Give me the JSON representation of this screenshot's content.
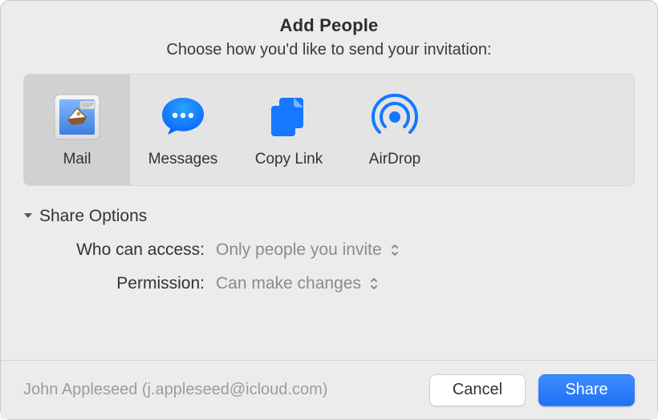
{
  "header": {
    "title": "Add People",
    "subtitle": "Choose how you'd like to send your invitation:"
  },
  "methods": [
    {
      "id": "mail",
      "label": "Mail",
      "icon": "mail-app-icon",
      "selected": true
    },
    {
      "id": "messages",
      "label": "Messages",
      "icon": "messages-icon",
      "selected": false
    },
    {
      "id": "copylink",
      "label": "Copy Link",
      "icon": "copy-link-icon",
      "selected": false
    },
    {
      "id": "airdrop",
      "label": "AirDrop",
      "icon": "airdrop-icon",
      "selected": false
    }
  ],
  "share_options": {
    "section_label": "Share Options",
    "expanded": true,
    "rows": {
      "access": {
        "label": "Who can access:",
        "value": "Only people you invite"
      },
      "permission": {
        "label": "Permission:",
        "value": "Can make changes"
      }
    }
  },
  "footer": {
    "account": "John Appleseed (j.appleseed@icloud.com)",
    "cancel_label": "Cancel",
    "share_label": "Share"
  },
  "colors": {
    "accent_blue": "#1f72f5"
  }
}
